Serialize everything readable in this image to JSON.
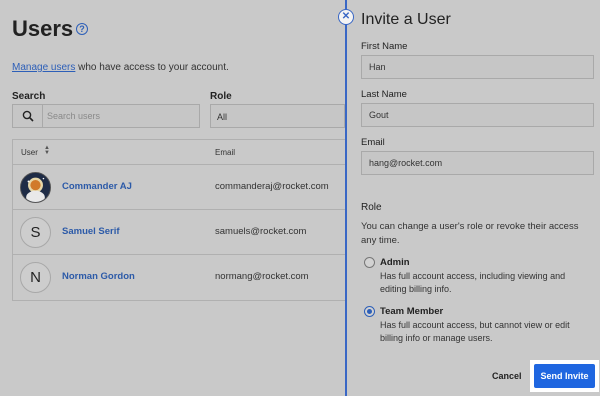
{
  "page": {
    "title": "Users",
    "help_glyph": "?",
    "intro_link": "Manage users",
    "intro_rest": " who have access to your account.",
    "search_label": "Search",
    "search_placeholder": "Search users",
    "role_label": "Role",
    "role_value": "All",
    "table": {
      "col_user": "User",
      "col_email": "Email",
      "rows": [
        {
          "name": "Commander AJ",
          "email": "commanderaj@rocket.com",
          "avatar": "image"
        },
        {
          "name": "Samuel Serif",
          "email": "samuels@rocket.com",
          "avatar": "S"
        },
        {
          "name": "Norman Gordon",
          "email": "normang@rocket.com",
          "avatar": "N"
        }
      ]
    }
  },
  "drawer": {
    "title": "Invite a User",
    "close_glyph": "✕",
    "first_name_label": "First Name",
    "first_name_value": "Han",
    "last_name_label": "Last Name",
    "last_name_value": "Gout",
    "email_label": "Email",
    "email_value": "hang@rocket.com",
    "role_section": "Role",
    "role_desc": "You can change a user's role or revoke their access any time.",
    "options": [
      {
        "name": "Admin",
        "desc": "Has full account access, including viewing and editing billing info.",
        "checked": false
      },
      {
        "name": "Team Member",
        "desc": "Has full account access, but cannot view or edit billing info or manage users.",
        "checked": true
      }
    ],
    "cancel_label": "Cancel",
    "send_label": "Send Invite"
  },
  "colors": {
    "accent": "#1f66e0",
    "link": "#2c5aa8",
    "overlay_bg": "#c9c9c9"
  }
}
